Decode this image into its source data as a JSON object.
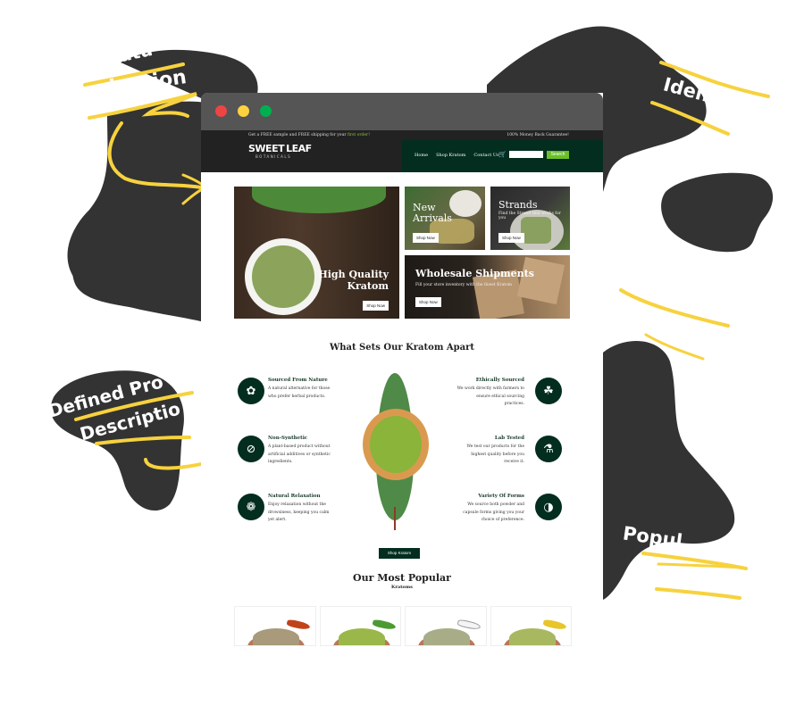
{
  "annotations": {
    "top_left": "igation",
    "top_left_partial": "eatu",
    "mid_left_line1": "Defined Pro",
    "mid_left_line2": "Descriptio",
    "top_right": "Ident",
    "bottom_right": "Popul"
  },
  "colors": {
    "highlight_yellow": "#f7d23e",
    "blob": "#333333",
    "brand_dark_green": "#022d1f",
    "brand_light_green": "#6bbf2a"
  },
  "browser": {
    "window_controls": [
      "close",
      "minimize",
      "maximize"
    ]
  },
  "header": {
    "promo_prefix": "Get a FREE sample and FREE shipping for your ",
    "promo_highlight": "first order!",
    "guarantee": "100% Money Back Guarantee!",
    "logo_word1": "SWEET",
    "logo_word2": "LEAF",
    "logo_sub": "BOTANICALS",
    "nav": [
      "Home",
      "Shop Kratom",
      "Contact Us"
    ],
    "search_placeholder": "",
    "search_button": "Search"
  },
  "hero": {
    "main": {
      "title_line1": "High Quality",
      "title_line2": "Kratom",
      "button": "Shop Now"
    },
    "new_arrivals": {
      "title_line1": "New",
      "title_line2": "Arrivals",
      "button": "Shop Now"
    },
    "strands": {
      "title": "Strands",
      "desc": "Find the Strand that works for you",
      "button": "Shop Now"
    },
    "wholesale": {
      "title": "Wholesale Shipments",
      "desc": "Fill your store inventory with the finest Kratom",
      "button": "Shop Now"
    }
  },
  "features": {
    "title": "What Sets Our Kratom Apart",
    "items": [
      {
        "title": "Sourced From Nature",
        "desc": "A natural alternative for those who prefer herbal products.",
        "icon": "leaf-icon"
      },
      {
        "title": "Non-Synthetic",
        "desc": "A plant-based product without artificial additives or synthetic ingredients.",
        "icon": "no-synthetic-icon"
      },
      {
        "title": "Natural Relaxation",
        "desc": "Enjoy relaxation without the drowsiness, keeping you calm yet alert.",
        "icon": "lotus-icon"
      },
      {
        "title": "Ethically Sourced",
        "desc": "We work directly with farmers to ensure ethical sourcing practices.",
        "icon": "hand-leaf-icon"
      },
      {
        "title": "Lab Tested",
        "desc": "We test our products for the highest quality before you receive it.",
        "icon": "flask-icon"
      },
      {
        "title": "Variety Of Forms",
        "desc": "We source both powder and capsule forms giving you your choice of preference.",
        "icon": "capsule-icon"
      }
    ],
    "cta": "Shop Kratom"
  },
  "popular": {
    "title": "Our Most Popular",
    "subtitle": "Kratoms",
    "products": [
      {
        "swatch": "#c0431c",
        "powder": "#a89a7a"
      },
      {
        "swatch": "#4c9a32",
        "powder": "#9ab84a"
      },
      {
        "swatch": "#f4f4f4",
        "powder": "#a8ad88"
      },
      {
        "swatch": "#e8c52a",
        "powder": "#a8b860"
      }
    ]
  }
}
